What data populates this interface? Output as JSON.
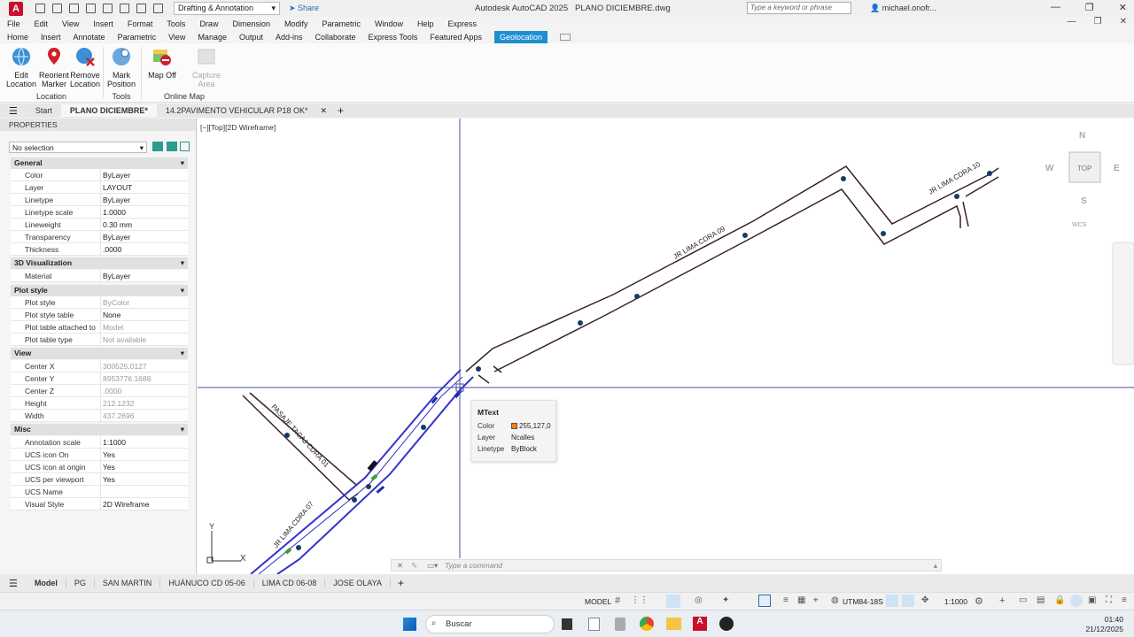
{
  "titlebar": {
    "workspace": "Drafting & Annotation",
    "share": "Share",
    "app_title": "Autodesk AutoCAD 2025",
    "file_title": "PLANO DICIEMBRE.dwg",
    "search_placeholder": "Type a keyword or phrase",
    "user": "michael.onofr..."
  },
  "menu": [
    "File",
    "Edit",
    "View",
    "Insert",
    "Format",
    "Tools",
    "Draw",
    "Dimension",
    "Modify",
    "Parametric",
    "Window",
    "Help",
    "Express"
  ],
  "ribbon_tabs": [
    "Home",
    "Insert",
    "Annotate",
    "Parametric",
    "View",
    "Manage",
    "Output",
    "Add-ins",
    "Collaborate",
    "Express Tools",
    "Featured Apps",
    "Geolocation"
  ],
  "ribbon": {
    "edit_location": "Edit Location",
    "reorient_marker": "Reorient Marker",
    "remove_location": "Remove Location",
    "location_title": "Location",
    "mark_position": "Mark Position",
    "tools_title": "Tools",
    "map_off": "Map Off",
    "capture_area": "Capture Area",
    "online_map_title": "Online Map"
  },
  "file_tabs": [
    "Start",
    "PLANO DICIEMBRE*",
    "14.2PAVIMENTO VEHICULAR P18 OK*"
  ],
  "properties": {
    "header": "PROPERTIES",
    "selection": "No selection",
    "sections": {
      "general": "General",
      "viz3d": "3D Visualization",
      "plot": "Plot style",
      "view": "View",
      "misc": "Misc"
    },
    "general": [
      {
        "k": "Color",
        "v": "ByLayer"
      },
      {
        "k": "Layer",
        "v": "LAYOUT"
      },
      {
        "k": "Linetype",
        "v": "ByLayer"
      },
      {
        "k": "Linetype scale",
        "v": "1.0000"
      },
      {
        "k": "Lineweight",
        "v": "0.30 mm"
      },
      {
        "k": "Transparency",
        "v": "ByLayer"
      },
      {
        "k": "Thickness",
        "v": ".0000"
      }
    ],
    "viz3d": [
      {
        "k": "Material",
        "v": "ByLayer"
      }
    ],
    "plot": [
      {
        "k": "Plot style",
        "v": "ByColor"
      },
      {
        "k": "Plot style table",
        "v": "None"
      },
      {
        "k": "Plot table attached to",
        "v": "Model"
      },
      {
        "k": "Plot table type",
        "v": "Not available"
      }
    ],
    "view": [
      {
        "k": "Center X",
        "v": "300525.0127"
      },
      {
        "k": "Center Y",
        "v": "8953776.1688"
      },
      {
        "k": "Center Z",
        "v": ".0000"
      },
      {
        "k": "Height",
        "v": "212.1232"
      },
      {
        "k": "Width",
        "v": "437.2696"
      }
    ],
    "misc": [
      {
        "k": "Annotation scale",
        "v": "1:1000"
      },
      {
        "k": "UCS icon On",
        "v": "Yes"
      },
      {
        "k": "UCS icon at origin",
        "v": "Yes"
      },
      {
        "k": "UCS per viewport",
        "v": "Yes"
      },
      {
        "k": "UCS Name",
        "v": ""
      },
      {
        "k": "Visual Style",
        "v": "2D Wireframe"
      }
    ]
  },
  "viewport_label": "[−][Top][2D Wireframe]",
  "drawing_labels": {
    "street1": "JR LIMA CDRA 09",
    "street2": "JR LIMA CDRA 10",
    "street3": "PASAJE TACAJ CDRA 01",
    "street4": "JR LIMA CDRA 07"
  },
  "viewcube": {
    "n": "N",
    "s": "S",
    "e": "E",
    "w": "W",
    "top": "TOP",
    "wcs": "WCS"
  },
  "ucs": {
    "x": "X",
    "y": "Y"
  },
  "tooltip": {
    "title": "MText",
    "color_label": "Color",
    "color_value": "255,127,0",
    "layer_label": "Layer",
    "layer_value": "Ncalles",
    "linetype_label": "Linetype",
    "linetype_value": "ByBlock",
    "swatch": "#ff7f00"
  },
  "command_placeholder": "Type a command",
  "layout_tabs": [
    "Model",
    "PG",
    "SAN MARTIN",
    "HUÁNUCO CD 05-06",
    "LIMA CD 06-08",
    "JOSE OLAYA"
  ],
  "status": {
    "model": "MODEL",
    "coord_sys": "UTM84-18S",
    "scale": "1:1000"
  },
  "taskbar": {
    "search": "Buscar",
    "time": "01:40",
    "date": "21/12/2025"
  },
  "colors": {
    "accent": "#1e8fd0",
    "line": "#3b2128",
    "selected": "#3333cc"
  }
}
